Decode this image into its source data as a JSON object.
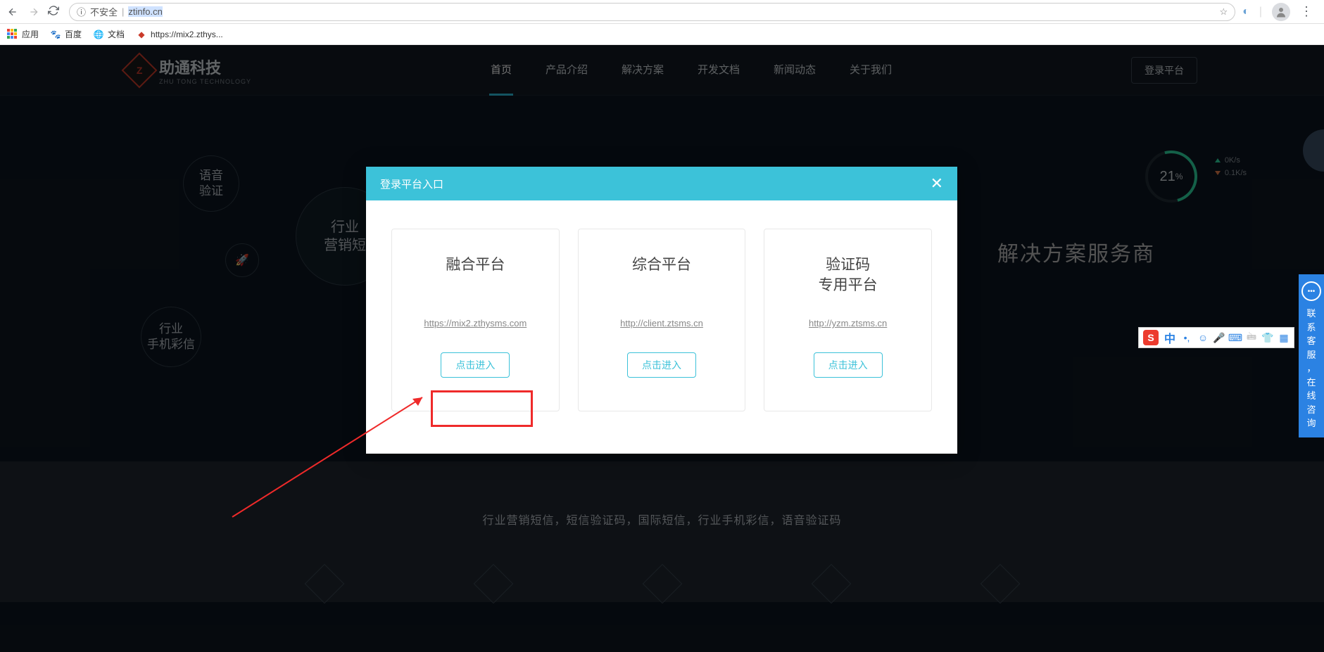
{
  "browser": {
    "insecure_label": "不安全",
    "url_display": "ztinfo.cn",
    "bookmarks": {
      "apps": "应用",
      "baidu": "百度",
      "docs": "文档",
      "mix2": "https://mix2.zthys..."
    }
  },
  "site": {
    "logo_main": "助通科技",
    "logo_sub": "ZHU TONG TECHNOLOGY",
    "nav": [
      "首页",
      "产品介绍",
      "解决方案",
      "开发文档",
      "新闻动态",
      "关于我们"
    ],
    "login": "登录平台",
    "hero_tagline": "解决方案服务商",
    "bubbles": {
      "b1a": "语音",
      "b1b": "验证",
      "b2a": "行业",
      "b2b": "营销短",
      "b3a": "行业",
      "b3b": "手机彩信"
    },
    "meter": {
      "value": "21",
      "unit": "%",
      "up": "0K/s",
      "down": "0.1K/s"
    },
    "section2": "行业营销短信，短信验证码，国际短信，行业手机彩信，语音验证码"
  },
  "modal": {
    "title": "登录平台入口",
    "cards": [
      {
        "title": "融合平台",
        "url": "https://mix2.zthysms.com",
        "btn": "点击进入"
      },
      {
        "title": "综合平台",
        "url": "http://client.ztsms.cn",
        "btn": "点击进入"
      },
      {
        "title": "验证码\n专用平台",
        "url": "http://yzm.ztsms.cn",
        "btn": "点击进入"
      }
    ]
  },
  "chat": {
    "label": "联系客服，在线咨询"
  },
  "ime": {
    "lang": "中"
  }
}
